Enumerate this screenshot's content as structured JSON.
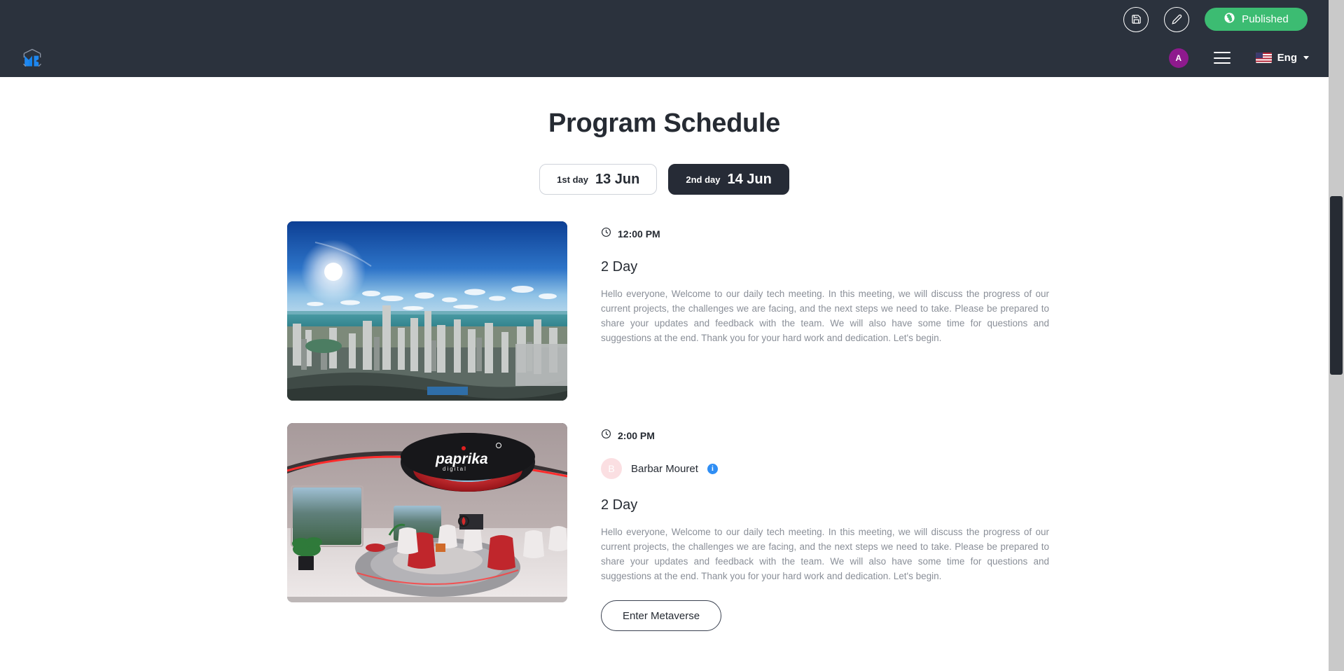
{
  "topbar": {
    "save_icon": "save-icon",
    "edit_icon": "pencil-icon",
    "publish_icon": "globe-icon",
    "publish_label": "Published",
    "publish_color": "#3cbc72"
  },
  "navbar": {
    "logo": "metaverse-cube-logo",
    "logo_color": "#1e87f0",
    "avatar_initial": "A",
    "avatar_color": "#8e1a8e",
    "menu_icon": "hamburger-menu-icon",
    "flag_icon": "us-flag-icon",
    "language": "Eng",
    "chevron_icon": "chevron-down-icon"
  },
  "page": {
    "title": "Program Schedule"
  },
  "day_tabs": [
    {
      "ordinal": "1st day",
      "date": "13 Jun",
      "active": false
    },
    {
      "ordinal": "2nd day",
      "date": "14 Jun",
      "active": true
    }
  ],
  "sessions": [
    {
      "time": "12:00 PM",
      "time_icon": "clock-icon",
      "title": "2 Day",
      "description": "Hello everyone, Welcome to our daily tech meeting. In this meeting, we will discuss the progress of our current projects, the challenges we are facing, and the next steps we need to take. Please be prepared to share your updates and feedback with the team. We will also have some time for questions and suggestions at the end. Thank you for your hard work and dedication. Let's begin.",
      "thumbnail": "aerial-city-panorama",
      "speaker": null,
      "button": null
    },
    {
      "time": "2:00 PM",
      "time_icon": "clock-icon",
      "title": "2 Day",
      "description": "Hello everyone, Welcome to our daily tech meeting. In this meeting, we will discuss the progress of our current projects, the challenges we are facing, and the next steps we need to take. Please be prepared to share your updates and feedback with the team. We will also have some time for questions and suggestions at the end. Thank you for your hard work and dedication. Let's begin.",
      "thumbnail": "metaverse-meeting-room",
      "speaker": {
        "name": "Barbar Mouret",
        "initial": "B",
        "avatar_color": "#fbdfe2",
        "info_icon": "info-icon"
      },
      "button": "Enter Metaverse"
    }
  ],
  "scrollbar": {
    "name": "vertical-scrollbar"
  }
}
